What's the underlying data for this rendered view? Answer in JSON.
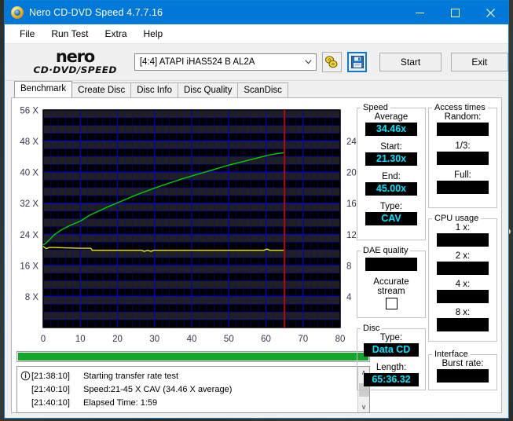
{
  "window": {
    "title": "Nero CD-DVD Speed 4.7.7.16",
    "icon": "nero-disc-icon",
    "controls": {
      "minimize": "−",
      "maximize": "□",
      "close": "×"
    }
  },
  "menu": {
    "items": [
      "File",
      "Run Test",
      "Extra",
      "Help"
    ]
  },
  "toolbar": {
    "logo_top": "nero",
    "logo_bottom": "CD·DVD∕SPEED",
    "drive_value": "[4:4]   ATAPI iHAS524  B AL2A",
    "drive_arrow": "⌄",
    "speed_tool_icon": "disc-speed-icon",
    "save_icon": "floppy-save-icon",
    "start_label": "Start",
    "exit_label": "Exit"
  },
  "tabs": {
    "items": [
      "Benchmark",
      "Create Disc",
      "Disc Info",
      "Disc Quality",
      "ScanDisc"
    ],
    "active": "Benchmark"
  },
  "chart_data": {
    "type": "line",
    "title": "",
    "xlabel": "",
    "ylabel": "",
    "xlim": [
      0,
      80
    ],
    "ylim": [
      0,
      56
    ],
    "y2lim": [
      0,
      28
    ],
    "grid": true,
    "background": "#000000",
    "grid_color": "#0000d0",
    "xticks": [
      0,
      10,
      20,
      30,
      40,
      50,
      60,
      70,
      80
    ],
    "xticklabels": [
      "0",
      "10",
      "20",
      "30",
      "40",
      "50",
      "60",
      "70",
      "80"
    ],
    "yticks": [
      8,
      16,
      24,
      32,
      40,
      48,
      56
    ],
    "yticklabels": [
      "8 X",
      "16 X",
      "24 X",
      "32 X",
      "40 X",
      "48 X",
      "56 X"
    ],
    "y2ticks": [
      4,
      8,
      12,
      16,
      20,
      24
    ],
    "y2ticklabels": [
      "4",
      "8",
      "12",
      "16",
      "20",
      "24"
    ],
    "marker_x": 65,
    "marker_color": "#e00000",
    "series": [
      {
        "name": "transfer-rate",
        "color": "#00d000",
        "x": [
          0.0,
          0.6,
          1.5,
          3.0,
          5.0,
          7.5,
          10.0,
          12.5,
          15.0,
          17.5,
          20.0,
          22.5,
          25.0,
          27.5,
          30.0,
          32.5,
          35.0,
          37.5,
          40.0,
          42.5,
          45.0,
          47.5,
          50.0,
          52.5,
          55.0,
          57.5,
          60.0,
          62.5,
          64.8
        ],
        "y": [
          21.3,
          21.6,
          22.4,
          23.9,
          25.2,
          26.4,
          27.4,
          28.9,
          30.0,
          31.1,
          32.1,
          33.1,
          34.1,
          35.0,
          35.9,
          36.7,
          37.5,
          38.3,
          39.0,
          39.7,
          40.4,
          41.1,
          41.8,
          42.4,
          43.0,
          43.6,
          44.2,
          44.7,
          45.0
        ]
      },
      {
        "name": "access-smoothing",
        "color": "#e8e800",
        "x": [
          0.0,
          0.8,
          1.6,
          3.0,
          6.0,
          10.0,
          12.8,
          13.2,
          20.0,
          26.5,
          27.2,
          28.2,
          29.0,
          29.8,
          40.0,
          50.0,
          59.5,
          60.3,
          61.0,
          64.8
        ],
        "y": [
          20.9,
          20.3,
          20.6,
          20.6,
          20.5,
          20.4,
          20.4,
          19.9,
          19.9,
          19.9,
          19.6,
          19.9,
          19.6,
          19.9,
          19.9,
          19.9,
          19.9,
          20.2,
          19.9,
          19.9
        ]
      }
    ]
  },
  "progress": {
    "percent": 100
  },
  "log": {
    "entries": [
      {
        "icon": "info-icon",
        "time": "[21:38:10]",
        "message": "Starting transfer rate test"
      },
      {
        "icon": "",
        "time": "[21:40:10]",
        "message": "Speed:21-45 X CAV (34.46 X average)"
      },
      {
        "icon": "",
        "time": "[21:40:10]",
        "message": "Elapsed Time:  1:59"
      }
    ],
    "scroll_up": "∧",
    "scroll_down": "∨"
  },
  "panels": {
    "speed": {
      "legend": "Speed",
      "average_label": "Average",
      "average_value": "34.46x",
      "start_label": "Start:",
      "start_value": "21.30x",
      "end_label": "End:",
      "end_value": "45.00x",
      "type_label": "Type:",
      "type_value": "CAV"
    },
    "dae": {
      "legend": "DAE quality",
      "quality_value": "",
      "accurate_line1": "Accurate",
      "accurate_line2": "stream",
      "checkbox_checked": false
    },
    "disc": {
      "legend": "Disc",
      "type_label": "Type:",
      "type_value": "Data CD",
      "length_label": "Length:",
      "length_value": "65:36.32"
    },
    "access": {
      "legend": "Access times",
      "random_label": "Random:",
      "random_value": "",
      "third_label": "1/3:",
      "third_value": "",
      "full_label": "Full:",
      "full_value": ""
    },
    "cpu": {
      "legend": "CPU usage",
      "x1_label": "1 x:",
      "x1_value": "",
      "x2_label": "2 x:",
      "x2_value": "",
      "x4_label": "4 x:",
      "x4_value": "",
      "x8_label": "8 x:",
      "x8_value": ""
    },
    "interface": {
      "legend": "Interface",
      "burst_label": "Burst rate:",
      "burst_value": ""
    }
  },
  "colors": {
    "accent": "#0078d7",
    "value_text": "#00e5ff",
    "progress": "#12a62a",
    "plot_line": "#00d000",
    "plot_line2": "#e8e800",
    "marker": "#e00000"
  }
}
